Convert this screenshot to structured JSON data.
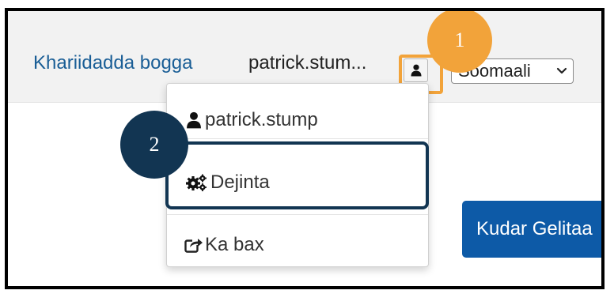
{
  "header": {
    "shop_link": "Khariidadda bogga",
    "username": "patrick.stum...",
    "user_icon": "user-icon",
    "language": "Soomaali"
  },
  "dropdown": {
    "items": [
      {
        "label": "patrick.stump",
        "icon": "user-icon"
      },
      {
        "label": "Dejinta",
        "icon": "gears-icon"
      },
      {
        "label": "Ka bax",
        "icon": "share-out-icon"
      }
    ]
  },
  "main": {
    "cta_label": "Kudar Gelitaa"
  },
  "annotations": {
    "badge_1": "1",
    "badge_2": "2"
  },
  "colors": {
    "link": "#1a5e96",
    "annotation_orange": "#f2a33a",
    "annotation_navy": "#123552",
    "button_blue": "#0d5aa7"
  }
}
